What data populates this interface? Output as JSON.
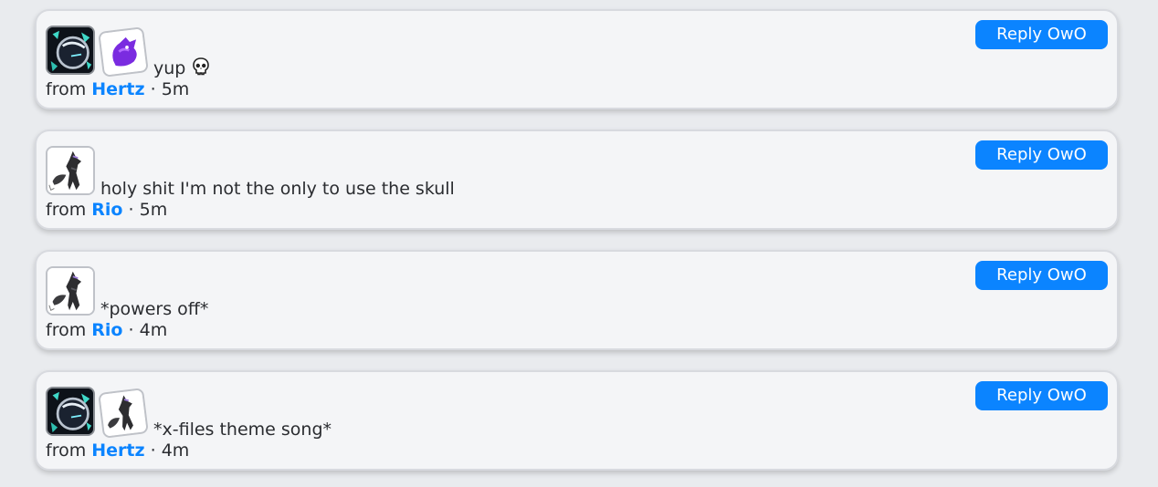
{
  "reply_label": "Reply OwO",
  "from_label": "from",
  "separator": "·",
  "colors": {
    "accent": "#0b84ff",
    "card": "#f4f5f7",
    "page": "#e9ebee"
  },
  "posts": [
    {
      "avatars": [
        "hertz-avatar",
        "purple-creature-avatar"
      ],
      "message": "yup",
      "emoji": "skull-icon",
      "user": "Hertz",
      "time": "5m"
    },
    {
      "avatars": [
        "rio-avatar"
      ],
      "message": "holy shit I'm not the only to use the skull",
      "user": "Rio",
      "time": "5m"
    },
    {
      "avatars": [
        "rio-avatar"
      ],
      "message": "*powers off*",
      "user": "Rio",
      "time": "4m"
    },
    {
      "avatars": [
        "hertz-avatar",
        "rio-avatar"
      ],
      "message": "*x-files theme song*",
      "user": "Hertz",
      "time": "4m"
    }
  ]
}
